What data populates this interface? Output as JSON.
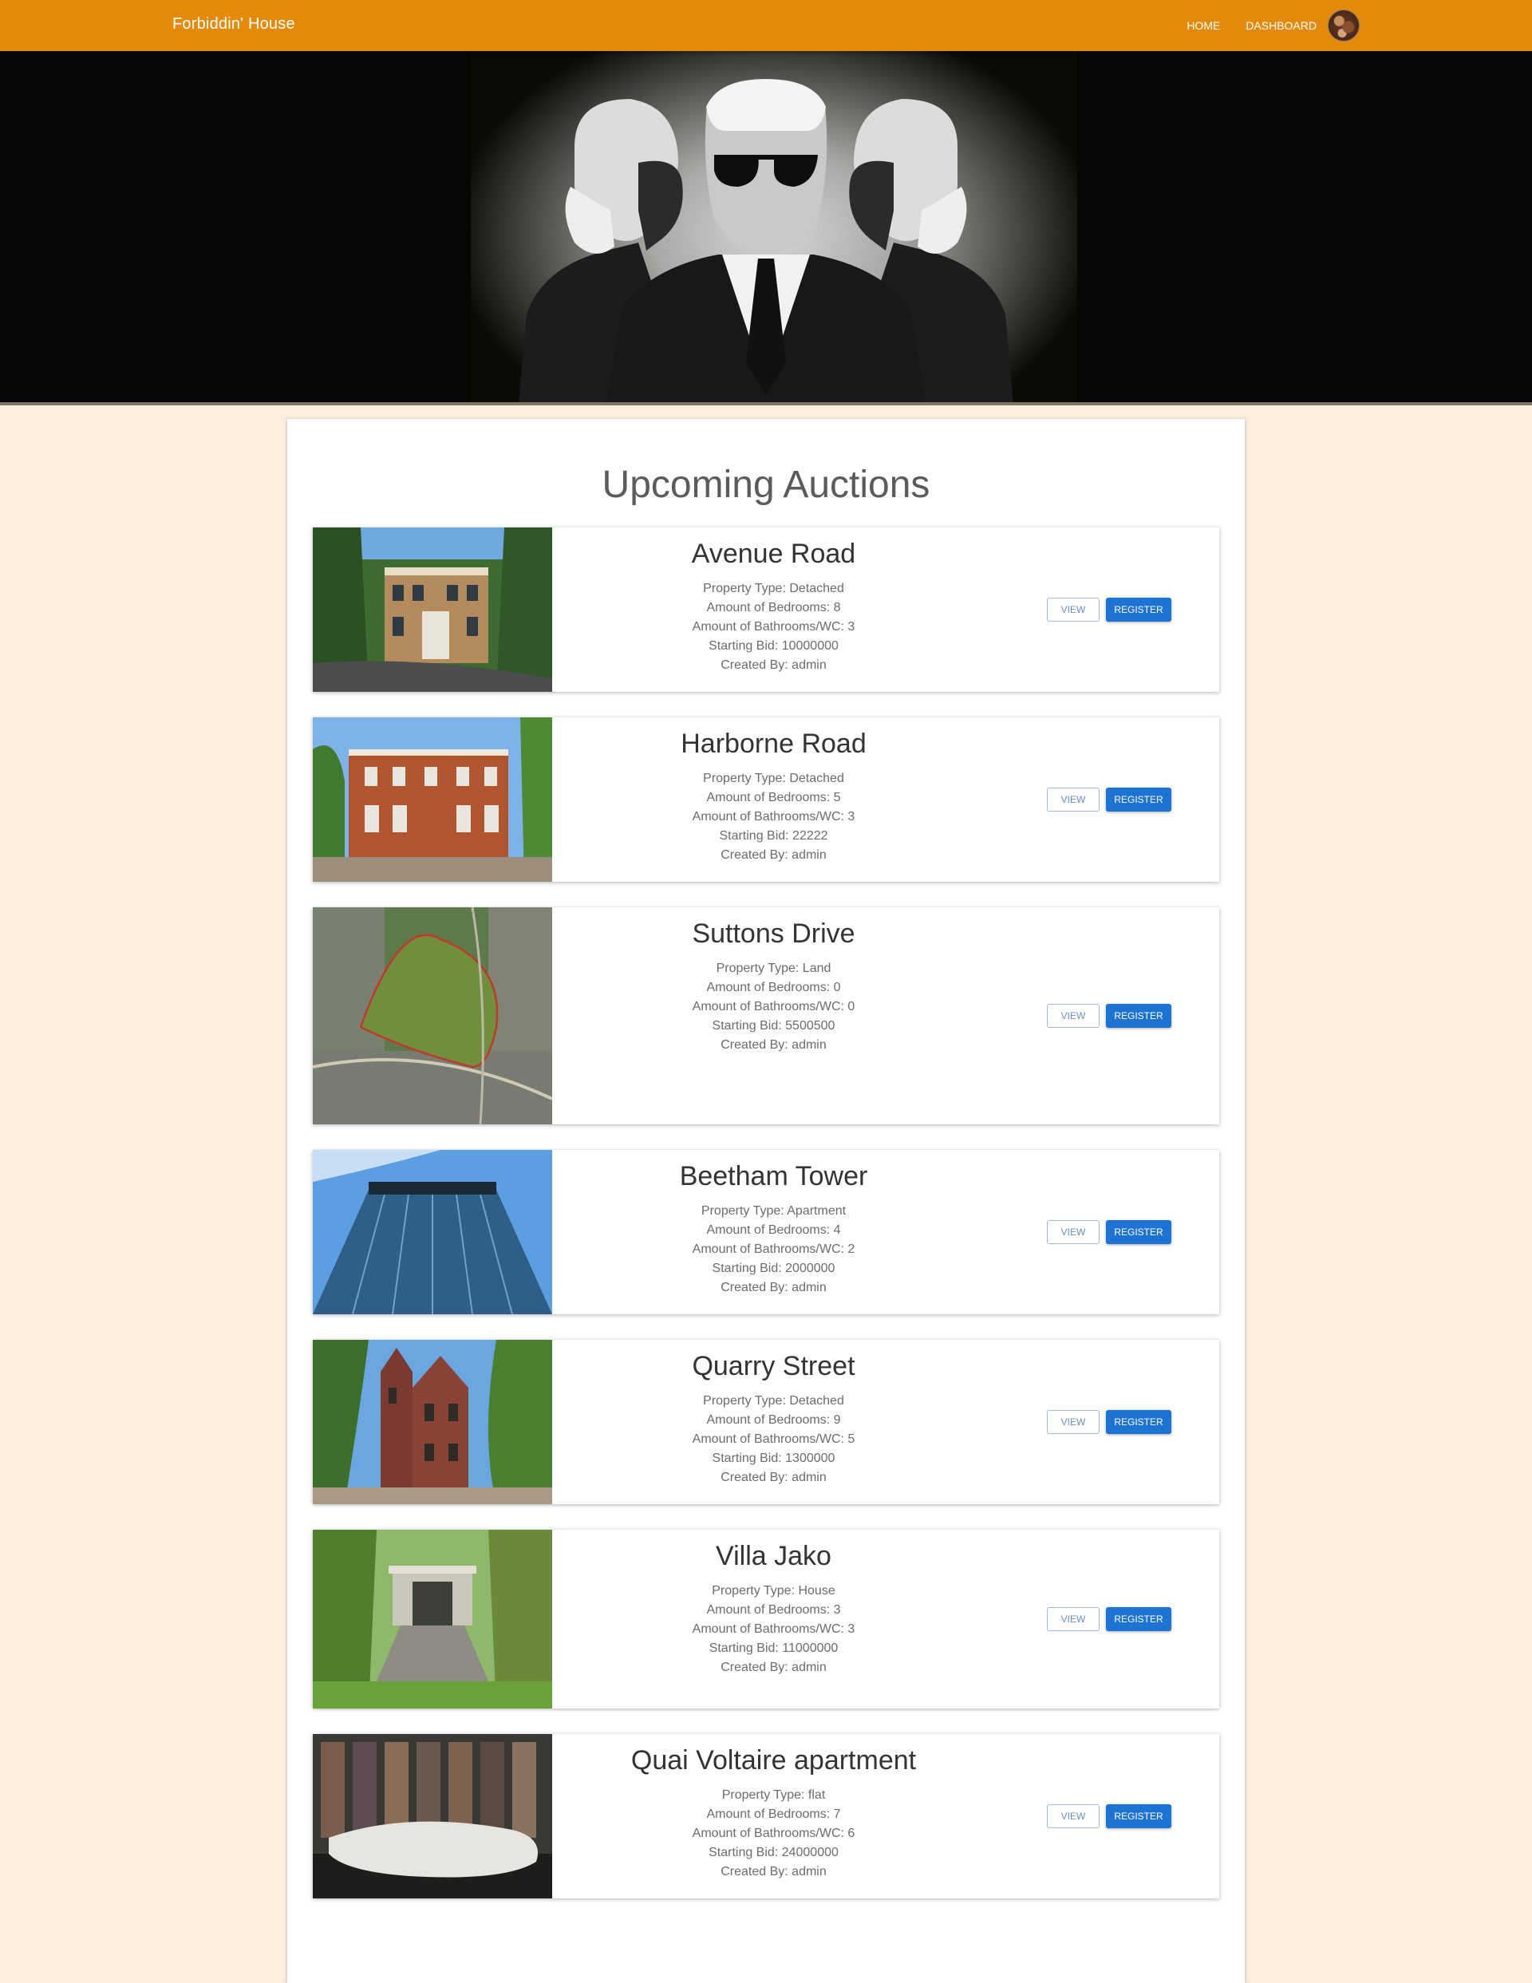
{
  "nav": {
    "brand": "Forbiddin' House",
    "home": "HOME",
    "dashboard": "DASHBOARD"
  },
  "main": {
    "title": "Upcoming Auctions",
    "view_label": "VIEW",
    "register_label": "REGISTER",
    "auctions": [
      {
        "name": "Avenue Road",
        "type": "Property Type: Detached",
        "bedrooms": "Amount of Bedrooms: 8",
        "bathrooms": "Amount of Bathrooms/WC: 3",
        "bid": "Starting Bid: 10000000",
        "creator": "Created By: admin"
      },
      {
        "name": "Harborne Road",
        "type": "Property Type: Detached",
        "bedrooms": "Amount of Bedrooms: 5",
        "bathrooms": "Amount of Bathrooms/WC: 3",
        "bid": "Starting Bid: 22222",
        "creator": "Created By: admin"
      },
      {
        "name": "Suttons Drive",
        "type": "Property Type: Land",
        "bedrooms": "Amount of Bedrooms: 0",
        "bathrooms": "Amount of Bathrooms/WC: 0",
        "bid": "Starting Bid: 5500500",
        "creator": "Created By: admin"
      },
      {
        "name": "Beetham Tower",
        "type": "Property Type: Apartment",
        "bedrooms": "Amount of Bedrooms: 4",
        "bathrooms": "Amount of Bathrooms/WC: 2",
        "bid": "Starting Bid: 2000000",
        "creator": "Created By: admin"
      },
      {
        "name": "Quarry Street",
        "type": "Property Type: Detached",
        "bedrooms": "Amount of Bedrooms: 9",
        "bathrooms": "Amount of Bathrooms/WC: 5",
        "bid": "Starting Bid: 1300000",
        "creator": "Created By: admin"
      },
      {
        "name": "Villa Jako",
        "type": "Property Type: House",
        "bedrooms": "Amount of Bedrooms: 3",
        "bathrooms": "Amount of Bathrooms/WC: 3",
        "bid": "Starting Bid: 11000000",
        "creator": "Created By: admin"
      },
      {
        "name": "Quai Voltaire apartment",
        "type": "Property Type: flat",
        "bedrooms": "Amount of Bedrooms: 7",
        "bathrooms": "Amount of Bathrooms/WC: 6",
        "bid": "Starting Bid: 24000000",
        "creator": "Created By: admin"
      }
    ]
  },
  "colors": {
    "navbar": "#e38a0b",
    "page_background": "#fcefdf",
    "register_button": "#1d73d1"
  },
  "icons": {
    "avatar": "user-avatar-photo"
  }
}
